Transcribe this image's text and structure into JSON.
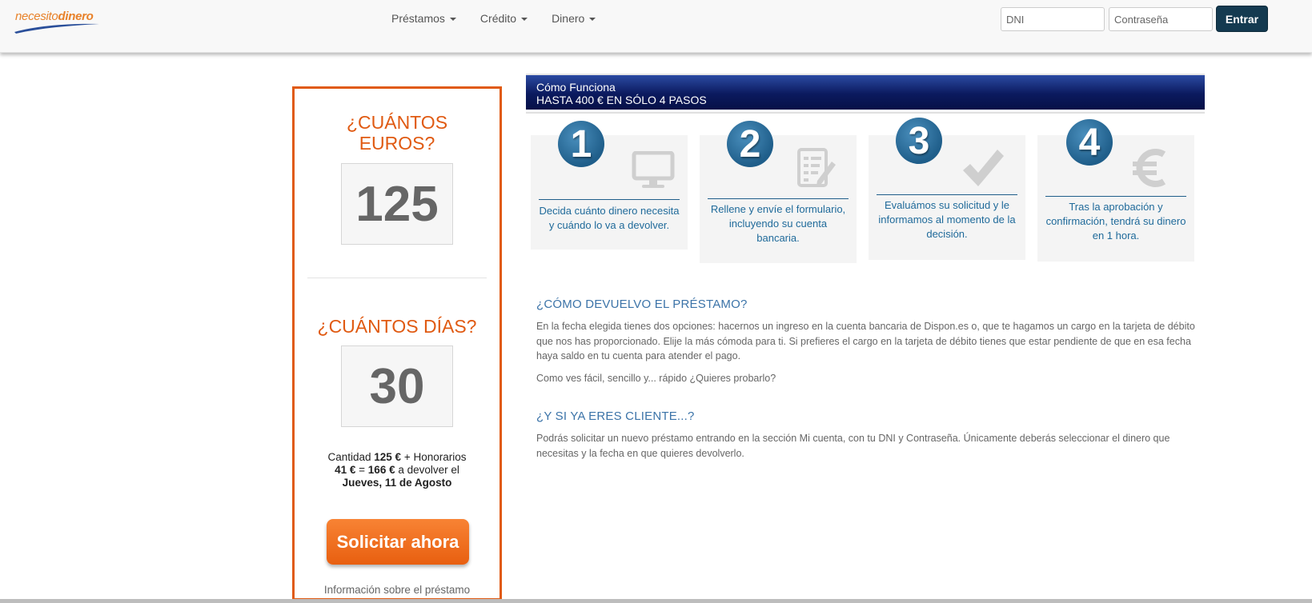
{
  "header": {
    "logo": {
      "part1": "necesito",
      "part2": "dinero"
    },
    "menu": [
      {
        "label": "Préstamos"
      },
      {
        "label": "Crédito"
      },
      {
        "label": "Dinero"
      }
    ],
    "login": {
      "dni_placeholder": "DNI",
      "password_placeholder": "Contraseña",
      "submit_label": "Entrar"
    }
  },
  "calculator": {
    "amount_heading": "¿CUÁNTOS EUROS?",
    "amount_value": "125",
    "days_heading": "¿CUÁNTOS DÍAS?",
    "days_value": "30",
    "summary": {
      "prefix": "Cantidad",
      "amount": "125 €",
      "fees_label": "+ Honorarios",
      "fees": "41 €",
      "equals": "=",
      "total": "166 €",
      "return_label": "a devolver el",
      "date": "Jueves, 11 de Agosto"
    },
    "apply_label": "Solicitar ahora",
    "info_link": "Información sobre el préstamo"
  },
  "how_it_works": {
    "title": "Cómo Funciona",
    "subtitle": "HASTA 400 € EN SÓLO 4 PASOS",
    "steps": [
      {
        "number": "1",
        "icon": "monitor-icon",
        "text": "Decida cuánto dinero necesita y cuándo lo va a devolver."
      },
      {
        "number": "2",
        "icon": "form-icon",
        "text": "Rellene y envíe el formulario, incluyendo su cuenta bancaria."
      },
      {
        "number": "3",
        "icon": "checkmark-icon",
        "text": "Evaluámos su solicitud y le informamos al momento de la decisión."
      },
      {
        "number": "4",
        "icon": "euro-icon",
        "text": "Tras la aprobación y confirmación, tendrá su dinero en 1 hora."
      }
    ]
  },
  "faq": [
    {
      "title": "¿CÓMO DEVUELVO EL PRÉSTAMO?",
      "paragraphs": [
        "En la fecha elegida tienes dos opciones: hacernos un ingreso en la cuenta bancaria de Dispon.es o, que te hagamos un cargo en la tarjeta de débito que nos has proporcionado. Elije la más cómoda para ti. Si prefieres el cargo en la tarjeta de débito tienes que estar pendiente de que en esa fecha haya saldo en tu cuenta para atender el pago.",
        "Como ves fácil, sencillo y... rápido ¿Quieres probarlo?"
      ]
    },
    {
      "title": "¿Y SI YA ERES CLIENTE...?",
      "paragraphs": [
        "Podrás solicitar un nuevo préstamo entrando en la sección Mi cuenta, con tu DNI y Contraseña. Únicamente deberás seleccionar el dinero que necesitas y la fecha en que quieres devolverlo."
      ]
    }
  ],
  "colors": {
    "accent_orange": "#e05a12",
    "navy": "#0b1a5e",
    "step_blue": "#1f5e8a",
    "link_blue": "#3b73a8"
  }
}
